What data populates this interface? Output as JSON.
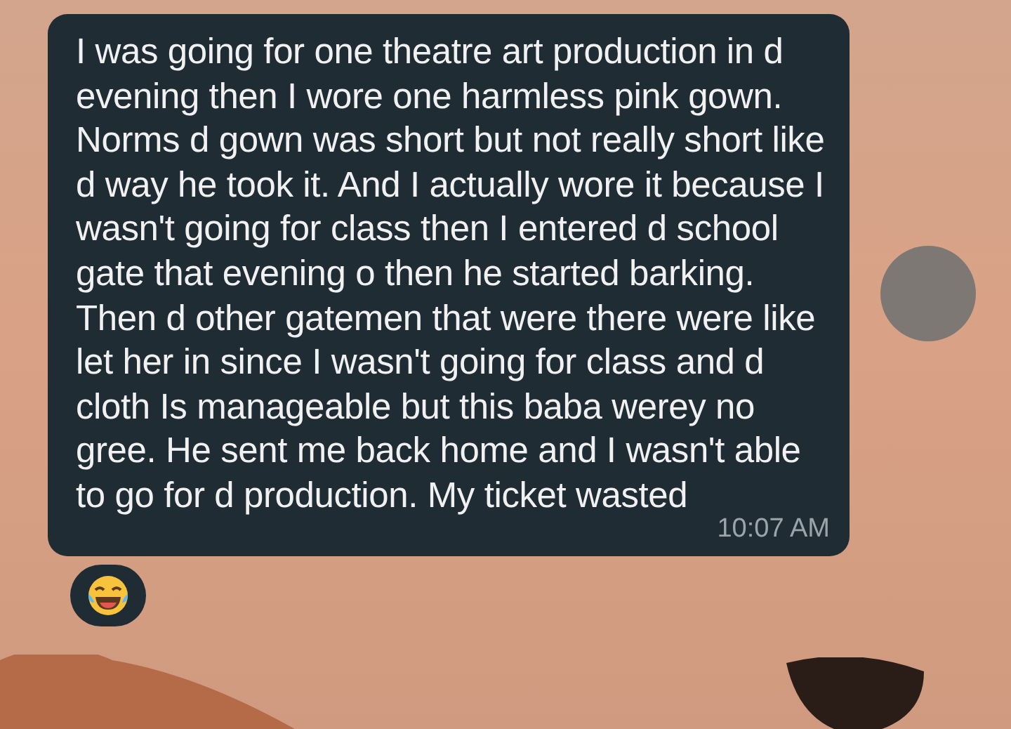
{
  "message": {
    "text": "I was going for one theatre art production in d evening then I wore one harmless pink gown. Norms d gown was short but not really short like d way he took it. And I actually wore it because I wasn't going for class then I entered d school gate that evening o then he started barking. Then d other gatemen that were there were like let her in since I wasn't going for class and d cloth Is manageable but this baba werey no gree. He sent me back home and I wasn't able to go for d production. My ticket wasted",
    "time": "10:07 AM"
  },
  "reaction": {
    "kind": "laughing-tears"
  }
}
